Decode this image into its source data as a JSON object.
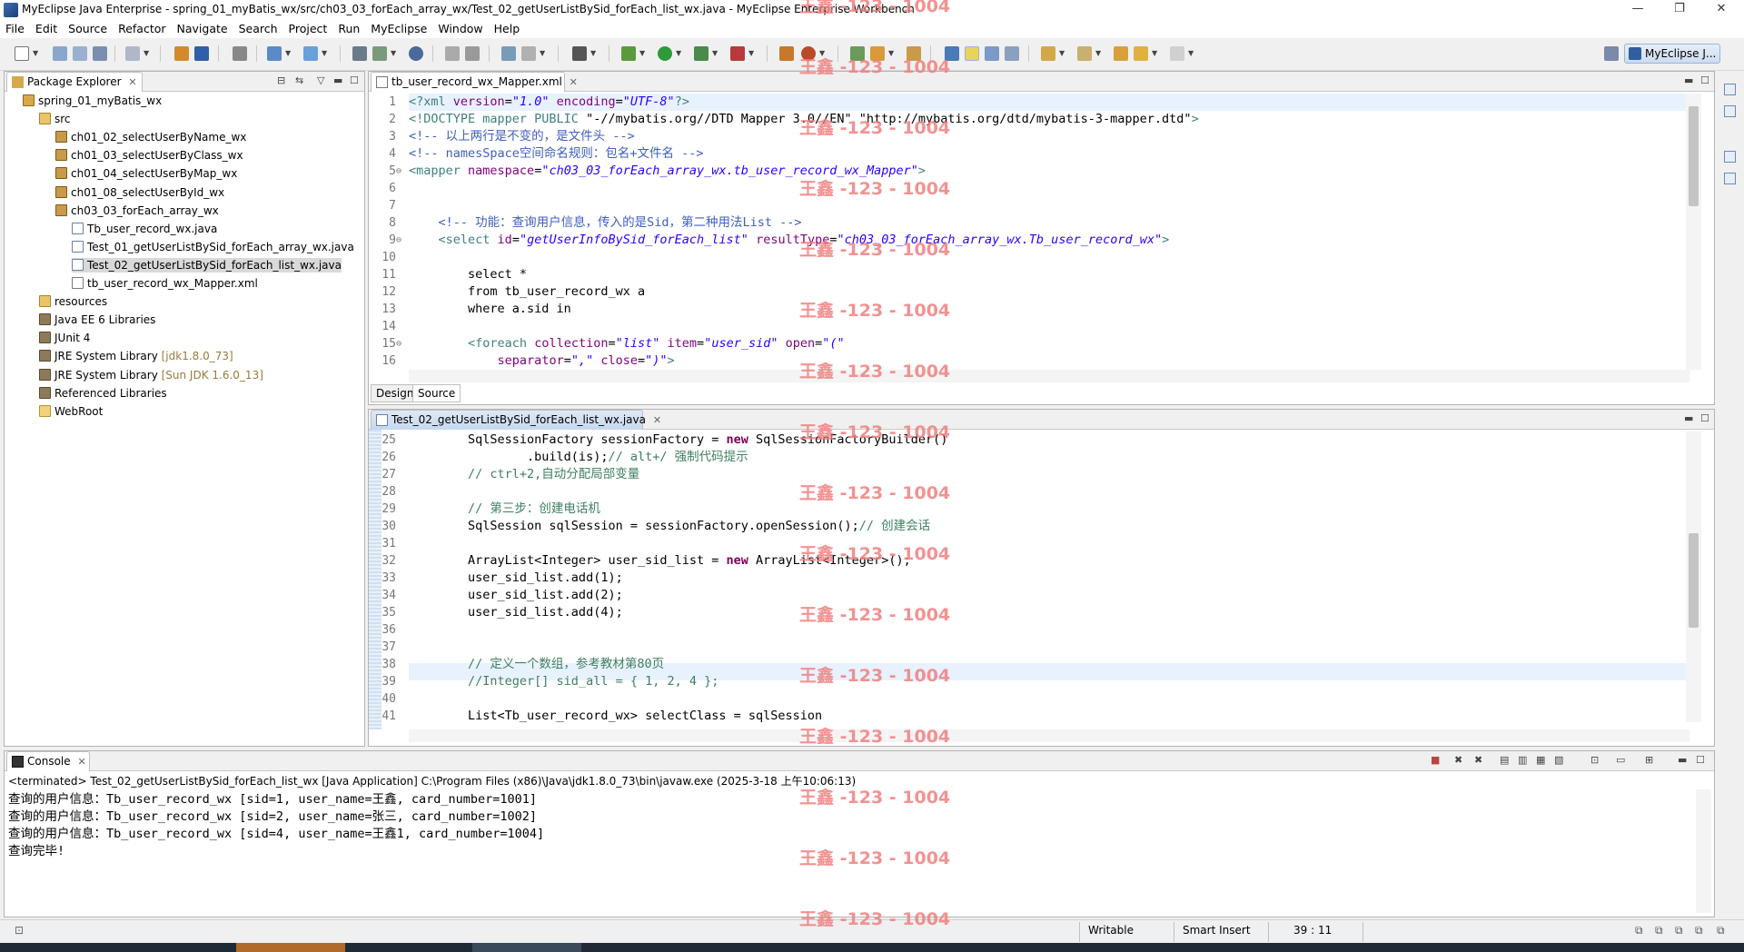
{
  "window": {
    "title": "MyEclipse Java Enterprise - spring_01_myBatis_wx/src/ch03_03_forEach_array_wx/Test_02_getUserListBySid_forEach_list_wx.java - MyEclipse Enterprise Workbench",
    "minimize": "—",
    "restore": "❐",
    "close": "✕"
  },
  "menu": [
    "File",
    "Edit",
    "Source",
    "Refactor",
    "Navigate",
    "Search",
    "Project",
    "Run",
    "MyEclipse",
    "Window",
    "Help"
  ],
  "perspective": {
    "label": "MyEclipse J..."
  },
  "package_explorer": {
    "tab_label": "Package Explorer",
    "tree": [
      {
        "label": "spring_01_myBatis_wx",
        "icon": "project-icon",
        "depth": 0
      },
      {
        "label": "src",
        "icon": "source-folder-icon",
        "depth": 1
      },
      {
        "label": "ch01_02_selectUserByName_wx",
        "icon": "package-icon",
        "depth": 2
      },
      {
        "label": "ch01_03_selectUserByClass_wx",
        "icon": "package-icon",
        "depth": 2
      },
      {
        "label": "ch01_04_selectUserByMap_wx",
        "icon": "package-icon",
        "depth": 2
      },
      {
        "label": "ch01_08_selectUserById_wx",
        "icon": "package-icon",
        "depth": 2
      },
      {
        "label": "ch03_03_forEach_array_wx",
        "icon": "package-icon",
        "depth": 2
      },
      {
        "label": "Tb_user_record_wx.java",
        "icon": "java-file-icon",
        "depth": 3
      },
      {
        "label": "Test_01_getUserListBySid_forEach_array_wx.java",
        "icon": "java-file-icon",
        "depth": 3
      },
      {
        "label": "Test_02_getUserListBySid_forEach_list_wx.java",
        "icon": "java-file-icon",
        "depth": 3,
        "selected": true
      },
      {
        "label": "tb_user_record_wx_Mapper.xml",
        "icon": "xml-file-icon",
        "depth": 3
      },
      {
        "label": "resources",
        "icon": "source-folder-icon",
        "depth": 1
      },
      {
        "label": "Java EE 6 Libraries",
        "icon": "library-icon",
        "depth": 1
      },
      {
        "label": "JUnit 4",
        "icon": "library-icon",
        "depth": 1
      },
      {
        "label": "JRE System Library",
        "suffix": "[jdk1.8.0_73]",
        "icon": "library-icon",
        "depth": 1
      },
      {
        "label": "JRE System Library",
        "suffix": "[Sun JDK 1.6.0_13]",
        "icon": "library-icon",
        "depth": 1
      },
      {
        "label": "Referenced Libraries",
        "icon": "library-icon",
        "depth": 1
      },
      {
        "label": "WebRoot",
        "icon": "folder-icon",
        "depth": 1
      }
    ]
  },
  "xml_editor": {
    "tab_label": "tb_user_record_wx_Mapper.xml",
    "lines": [
      {
        "n": "1",
        "fold": "",
        "parts": [
          [
            "c-tag",
            "<?xml "
          ],
          [
            "c-attr",
            "version"
          ],
          [
            "c-plain",
            "="
          ],
          [
            "c-str",
            "\"1.0\""
          ],
          [
            "c-plain",
            " "
          ],
          [
            "c-attr",
            "encoding"
          ],
          [
            "c-plain",
            "="
          ],
          [
            "c-str",
            "\"UTF-8\""
          ],
          [
            "c-tag",
            "?>"
          ]
        ]
      },
      {
        "n": "2",
        "fold": "",
        "parts": [
          [
            "c-tag",
            "<!DOCTYPE mapper PUBLIC "
          ],
          [
            "c-plain",
            "\"-//mybatis.org//DTD Mapper 3.0//EN\" \"http://mybatis.org/dtd/mybatis-3-mapper.dtd\""
          ],
          [
            "c-tag",
            ">"
          ]
        ]
      },
      {
        "n": "3",
        "fold": "",
        "parts": [
          [
            "c-com",
            "<!-- 以上两行是不变的，是文件头 -->"
          ]
        ]
      },
      {
        "n": "4",
        "fold": "",
        "parts": [
          [
            "c-com",
            "<!-- namesSpace空间命名规则：包名+文件名 -->"
          ]
        ]
      },
      {
        "n": "5",
        "fold": "⊖",
        "parts": [
          [
            "c-tag",
            "<mapper "
          ],
          [
            "c-attr",
            "namespace"
          ],
          [
            "c-plain",
            "="
          ],
          [
            "c-str",
            "\"ch03_03_forEach_array_wx.tb_user_record_wx_Mapper\""
          ],
          [
            "c-tag",
            ">"
          ]
        ]
      },
      {
        "n": "6",
        "fold": "",
        "parts": []
      },
      {
        "n": "7",
        "fold": "",
        "parts": []
      },
      {
        "n": "8",
        "fold": "",
        "parts": [
          [
            "c-plain",
            "    "
          ],
          [
            "c-com",
            "<!-- 功能：查询用户信息，传入的是Sid，第二种用法List -->"
          ]
        ]
      },
      {
        "n": "9",
        "fold": "⊖",
        "parts": [
          [
            "c-plain",
            "    "
          ],
          [
            "c-tag",
            "<select "
          ],
          [
            "c-attr",
            "id"
          ],
          [
            "c-plain",
            "="
          ],
          [
            "c-str",
            "\"getUserInfoBySid_forEach_list\""
          ],
          [
            "c-plain",
            " "
          ],
          [
            "c-attr",
            "resultType"
          ],
          [
            "c-plain",
            "="
          ],
          [
            "c-str",
            "\"ch03_03_forEach_array_wx.Tb_user_record_wx\""
          ],
          [
            "c-tag",
            ">"
          ]
        ]
      },
      {
        "n": "10",
        "fold": "",
        "parts": []
      },
      {
        "n": "11",
        "fold": "",
        "parts": [
          [
            "c-plain",
            "        select *"
          ]
        ]
      },
      {
        "n": "12",
        "fold": "",
        "parts": [
          [
            "c-plain",
            "        from tb_user_record_wx a"
          ]
        ]
      },
      {
        "n": "13",
        "fold": "",
        "parts": [
          [
            "c-plain",
            "        where a.sid in"
          ]
        ]
      },
      {
        "n": "14",
        "fold": "",
        "parts": []
      },
      {
        "n": "15",
        "fold": "⊖",
        "parts": [
          [
            "c-plain",
            "        "
          ],
          [
            "c-tag",
            "<foreach "
          ],
          [
            "c-attr",
            "collection"
          ],
          [
            "c-plain",
            "="
          ],
          [
            "c-str",
            "\"list\""
          ],
          [
            "c-plain",
            " "
          ],
          [
            "c-attr",
            "item"
          ],
          [
            "c-plain",
            "="
          ],
          [
            "c-str",
            "\"user_sid\""
          ],
          [
            "c-plain",
            " "
          ],
          [
            "c-attr",
            "open"
          ],
          [
            "c-plain",
            "="
          ],
          [
            "c-str",
            "\"(\""
          ]
        ]
      },
      {
        "n": "16",
        "fold": "",
        "parts": [
          [
            "c-plain",
            "            "
          ],
          [
            "c-attr",
            "separator"
          ],
          [
            "c-plain",
            "="
          ],
          [
            "c-str",
            "\",\""
          ],
          [
            "c-plain",
            " "
          ],
          [
            "c-attr",
            "close"
          ],
          [
            "c-plain",
            "="
          ],
          [
            "c-str",
            "\")\""
          ],
          [
            "c-tag",
            ">"
          ]
        ]
      }
    ],
    "design_tab": "Design",
    "source_tab": "Source"
  },
  "java_editor": {
    "tab_label": "Test_02_getUserListBySid_forEach_list_wx.java",
    "lines": [
      {
        "n": "25",
        "parts": [
          [
            "c-plain",
            "        SqlSessionFactory sessionFactory = "
          ],
          [
            "c-kw",
            "new"
          ],
          [
            "c-plain",
            " SqlSessionFactoryBuilder()"
          ]
        ]
      },
      {
        "n": "26",
        "parts": [
          [
            "c-plain",
            "                .build(is);"
          ],
          [
            "c-jcom",
            "// alt+/ 强制代码提示"
          ]
        ]
      },
      {
        "n": "27",
        "parts": [
          [
            "c-jcom",
            "        // ctrl+2,自动分配局部变量"
          ]
        ]
      },
      {
        "n": "28",
        "parts": []
      },
      {
        "n": "29",
        "parts": [
          [
            "c-jcom",
            "        // 第三步：创建电话机"
          ]
        ]
      },
      {
        "n": "30",
        "parts": [
          [
            "c-plain",
            "        SqlSession sqlSession = sessionFactory.openSession();"
          ],
          [
            "c-jcom",
            "// 创建会话"
          ]
        ]
      },
      {
        "n": "31",
        "parts": []
      },
      {
        "n": "32",
        "parts": [
          [
            "c-plain",
            "        ArrayList<Integer> user_sid_list = "
          ],
          [
            "c-kw",
            "new"
          ],
          [
            "c-plain",
            " ArrayList<Integer>();"
          ]
        ]
      },
      {
        "n": "33",
        "parts": [
          [
            "c-plain",
            "        user_sid_list.add(1);"
          ]
        ]
      },
      {
        "n": "34",
        "parts": [
          [
            "c-plain",
            "        user_sid_list.add(2);"
          ]
        ]
      },
      {
        "n": "35",
        "parts": [
          [
            "c-plain",
            "        user_sid_list.add(4);"
          ]
        ]
      },
      {
        "n": "36",
        "parts": []
      },
      {
        "n": "37",
        "parts": []
      },
      {
        "n": "38",
        "parts": [
          [
            "c-jcom",
            "        // 定义一个数组，参考教材第80页"
          ]
        ]
      },
      {
        "n": "39",
        "parts": [
          [
            "c-jcom",
            "        //Integer[] sid_all = { 1, 2, 4 };"
          ]
        ]
      },
      {
        "n": "40",
        "parts": []
      },
      {
        "n": "41",
        "parts": [
          [
            "c-plain",
            "        List<Tb_user_record_wx> selectClass = sqlSession"
          ]
        ]
      }
    ]
  },
  "console": {
    "tab_label": "Console",
    "header": "<terminated> Test_02_getUserListBySid_forEach_list_wx [Java Application] C:\\Program Files (x86)\\Java\\jdk1.8.0_73\\bin\\javaw.exe (2025-3-18 上午10:06:13)",
    "lines": [
      "查询的用户信息：Tb_user_record_wx [sid=1, user_name=王鑫, card_number=1001]",
      "查询的用户信息：Tb_user_record_wx [sid=2, user_name=张三, card_number=1002]",
      "查询的用户信息：Tb_user_record_wx [sid=4, user_name=王鑫1, card_number=1004]",
      "查询完毕!"
    ]
  },
  "status": {
    "writable": "Writable",
    "insert_mode": "Smart Insert",
    "position": "39 : 11"
  },
  "watermark": {
    "text": "王鑫 -123 - 1004",
    "color": "#f08080"
  },
  "colors": {
    "selection": "#d9d9d9",
    "current_line": "#e8f2fe",
    "watermark": "#f08080"
  }
}
